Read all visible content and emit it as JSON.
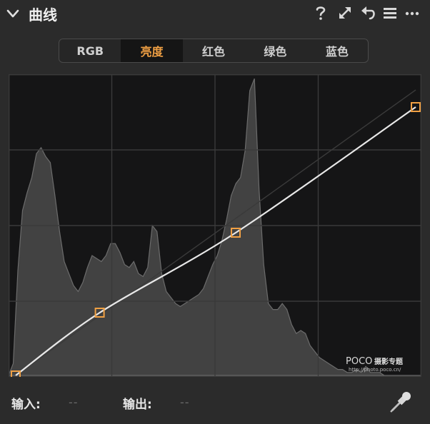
{
  "panel": {
    "title": "曲线"
  },
  "icons": [
    "chevron-down-icon",
    "help-icon",
    "expand-icon",
    "undo-icon",
    "menu-icon",
    "more-icon",
    "eyedropper-icon"
  ],
  "tabs": [
    {
      "label": "RGB",
      "active": false
    },
    {
      "label": "亮度",
      "active": true
    },
    {
      "label": "红色",
      "active": false
    },
    {
      "label": "绿色",
      "active": false
    },
    {
      "label": "蓝色",
      "active": false
    }
  ],
  "curve": {
    "accent": "#f0a044",
    "points": [
      [
        0,
        0
      ],
      [
        0.21,
        0.22
      ],
      [
        0.55,
        0.5
      ],
      [
        1,
        0.94
      ]
    ]
  },
  "histogram": {
    "values": [
      0.0,
      0.04,
      0.35,
      0.55,
      0.61,
      0.66,
      0.74,
      0.76,
      0.73,
      0.71,
      0.6,
      0.48,
      0.38,
      0.34,
      0.3,
      0.28,
      0.31,
      0.36,
      0.4,
      0.39,
      0.38,
      0.4,
      0.44,
      0.44,
      0.41,
      0.37,
      0.36,
      0.38,
      0.34,
      0.33,
      0.36,
      0.5,
      0.48,
      0.34,
      0.28,
      0.26,
      0.24,
      0.23,
      0.24,
      0.25,
      0.26,
      0.27,
      0.29,
      0.33,
      0.37,
      0.4,
      0.45,
      0.52,
      0.6,
      0.64,
      0.66,
      0.75,
      0.95,
      0.99,
      0.62,
      0.37,
      0.24,
      0.22,
      0.22,
      0.24,
      0.22,
      0.17,
      0.14,
      0.15,
      0.14,
      0.1,
      0.08,
      0.06,
      0.05,
      0.04,
      0.03,
      0.02,
      0.02,
      0.01,
      0.01,
      0.02,
      0.01,
      0.03,
      0.01,
      0.01,
      0.01,
      0.0,
      0.0,
      0.0,
      0.0,
      0.0,
      0.0,
      0.0,
      0.0,
      0.0
    ]
  },
  "watermark": {
    "brand": "POCO",
    "tagline": "摄影专题",
    "url": "http://photo.poco.cn/"
  },
  "footer": {
    "input_label": "输入:",
    "input_value": "--",
    "output_label": "输出:",
    "output_value": "--"
  }
}
